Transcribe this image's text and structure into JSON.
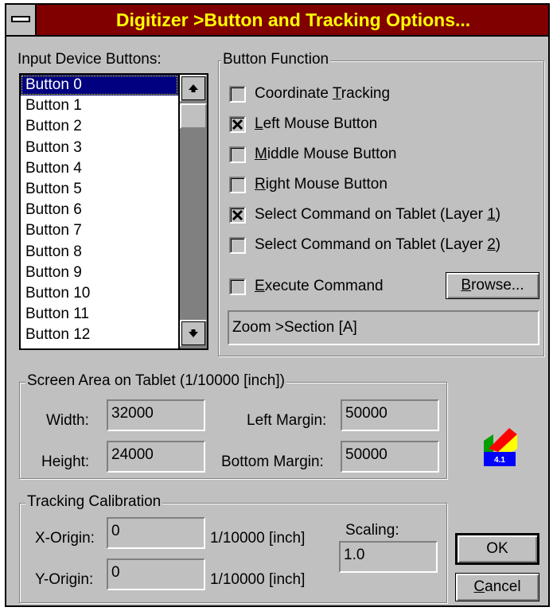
{
  "window": {
    "title": "Digitizer >Button and Tracking Options..."
  },
  "input_device_buttons": {
    "label": "Input Device Buttons:",
    "items": [
      "Button 0",
      "Button 1",
      "Button 2",
      "Button 3",
      "Button 4",
      "Button 5",
      "Button 6",
      "Button 7",
      "Button 8",
      "Button 9",
      "Button 10",
      "Button 11",
      "Button 12"
    ],
    "selected_index": 0
  },
  "button_function": {
    "label": "Button Function",
    "options": [
      {
        "pre": "Coordinate ",
        "key": "T",
        "post": "racking",
        "checked": false
      },
      {
        "pre": "",
        "key": "L",
        "post": "eft Mouse Button",
        "checked": true
      },
      {
        "pre": "",
        "key": "M",
        "post": "iddle Mouse Button",
        "checked": false
      },
      {
        "pre": "",
        "key": "R",
        "post": "ight Mouse Button",
        "checked": false
      },
      {
        "pre": "Select Command on Tablet (Layer ",
        "key": "1",
        "post": ")",
        "checked": true
      },
      {
        "pre": "Select Command on Tablet (Layer ",
        "key": "2",
        "post": ")",
        "checked": false
      },
      {
        "pre": "",
        "key": "E",
        "post": "xecute Command",
        "checked": false
      }
    ],
    "browse_key": "B",
    "browse_rest": "rowse...",
    "command_value": "Zoom >Section [A]"
  },
  "screen_area": {
    "label": "Screen Area on Tablet (1/10000 [inch])",
    "width_label": "Width:",
    "width_value": "32000",
    "height_label": "Height:",
    "height_value": "24000",
    "left_margin_label": "Left Margin:",
    "left_margin_value": "50000",
    "bottom_margin_label": "Bottom Margin:",
    "bottom_margin_value": "50000"
  },
  "tracking_calibration": {
    "label": "Tracking Calibration",
    "x_origin_label": "X-Origin:",
    "x_origin_value": "0",
    "x_unit": "1/10000 [inch]",
    "y_origin_label": "Y-Origin:",
    "y_origin_value": "0",
    "y_unit": "1/10000 [inch]",
    "scaling_label": "Scaling:",
    "scaling_value": "1.0"
  },
  "logo": {
    "version": "4.1",
    "colors": {
      "red": "#ff0000",
      "yellow": "#ffff00",
      "green": "#00a000",
      "blue": "#0000ff"
    }
  },
  "buttons": {
    "ok_label": "OK",
    "cancel_key": "C",
    "cancel_rest": "ancel"
  }
}
